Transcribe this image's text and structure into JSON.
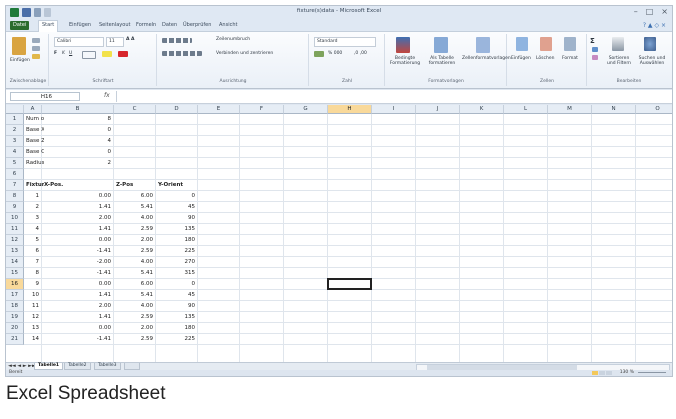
{
  "window": {
    "title": "fixture(s)data - Microsoft Excel",
    "minimize": "–",
    "maximize": "□",
    "close": "×",
    "help": "? ▲ ◇ ×"
  },
  "tabs": {
    "file": "Datei",
    "home": "Start",
    "insert": "Einfügen",
    "layout": "Seitenlayout",
    "formulas": "Formeln",
    "data": "Daten",
    "review": "Überprüfen",
    "view": "Ansicht"
  },
  "ribbon": {
    "clipboard_label": "Zwischenablage",
    "paste": "Einfügen",
    "font_label": "Schriftart",
    "font_name": "Calibri",
    "font_size": "11",
    "align_label": "Ausrichtung",
    "wrap_text": "Zeilenumbruch",
    "merge_center": "Verbinden und zentrieren",
    "number_label": "Zahl",
    "number_format": "Standard",
    "styles_label": "Formatvorlagen",
    "cond_format": "Bedingte Formatierung",
    "as_table": "Als Tabelle formatieren",
    "cell_styles": "Zellenformatvorlagen",
    "cells_label": "Zellen",
    "insert_btn": "Einfügen",
    "delete_btn": "Löschen",
    "format_btn": "Format",
    "edit_label": "Bearbeiten",
    "sort_filter": "Sortieren und Filtern",
    "find_select": "Suchen und Auswählen"
  },
  "formula_bar": {
    "name_box": "H16",
    "fx": "fx",
    "content": ""
  },
  "columns": [
    "A",
    "B",
    "C",
    "D",
    "E",
    "F",
    "G",
    "H",
    "I",
    "J",
    "K",
    "L",
    "M",
    "N",
    "O"
  ],
  "selected_column": "H",
  "selected_row": 16,
  "rows": [
    {
      "n": 1,
      "a": "Num of Fixtures",
      "b": "8",
      "c": "",
      "d": ""
    },
    {
      "n": 2,
      "a": "Base X",
      "b": "0",
      "c": "",
      "d": ""
    },
    {
      "n": 3,
      "a": "Base Z",
      "b": "4",
      "c": "",
      "d": ""
    },
    {
      "n": 4,
      "a": "Base Orient",
      "b": "0",
      "c": "",
      "d": ""
    },
    {
      "n": 5,
      "a": "Radius",
      "b": "2",
      "c": "",
      "d": ""
    },
    {
      "n": 6,
      "a": "",
      "b": "",
      "c": "",
      "d": ""
    },
    {
      "n": 7,
      "a": "Fixture",
      "b": "X-Pos.",
      "c": "Z-Pos",
      "d": "Y-Orient",
      "header": true
    },
    {
      "n": 8,
      "a": "1",
      "b": "0.00",
      "c": "6.00",
      "d": "0"
    },
    {
      "n": 9,
      "a": "2",
      "b": "1.41",
      "c": "5.41",
      "d": "45"
    },
    {
      "n": 10,
      "a": "3",
      "b": "2.00",
      "c": "4.00",
      "d": "90"
    },
    {
      "n": 11,
      "a": "4",
      "b": "1.41",
      "c": "2.59",
      "d": "135"
    },
    {
      "n": 12,
      "a": "5",
      "b": "0.00",
      "c": "2.00",
      "d": "180"
    },
    {
      "n": 13,
      "a": "6",
      "b": "-1.41",
      "c": "2.59",
      "d": "225"
    },
    {
      "n": 14,
      "a": "7",
      "b": "-2.00",
      "c": "4.00",
      "d": "270"
    },
    {
      "n": 15,
      "a": "8",
      "b": "-1.41",
      "c": "5.41",
      "d": "315"
    },
    {
      "n": 16,
      "a": "9",
      "b": "0.00",
      "c": "6.00",
      "d": "0"
    },
    {
      "n": 17,
      "a": "10",
      "b": "1.41",
      "c": "5.41",
      "d": "45"
    },
    {
      "n": 18,
      "a": "11",
      "b": "2.00",
      "c": "4.00",
      "d": "90"
    },
    {
      "n": 19,
      "a": "12",
      "b": "1.41",
      "c": "2.59",
      "d": "135"
    },
    {
      "n": 20,
      "a": "13",
      "b": "0.00",
      "c": "2.00",
      "d": "180"
    },
    {
      "n": 21,
      "a": "14",
      "b": "-1.41",
      "c": "2.59",
      "d": "225"
    }
  ],
  "sheets": {
    "nav": "◄◄ ◄ ► ►►",
    "tabs": [
      "Tabelle1",
      "Tabelle2",
      "Tabelle3"
    ],
    "active": "Tabelle1"
  },
  "status": {
    "ready": "Bereit",
    "zoom": "130 %"
  },
  "caption": "Excel Spreadsheet",
  "colors": {
    "file_tab": "#2a6b2e",
    "selected_header": "#f9d99a",
    "header_bg": "#e6edf5"
  }
}
